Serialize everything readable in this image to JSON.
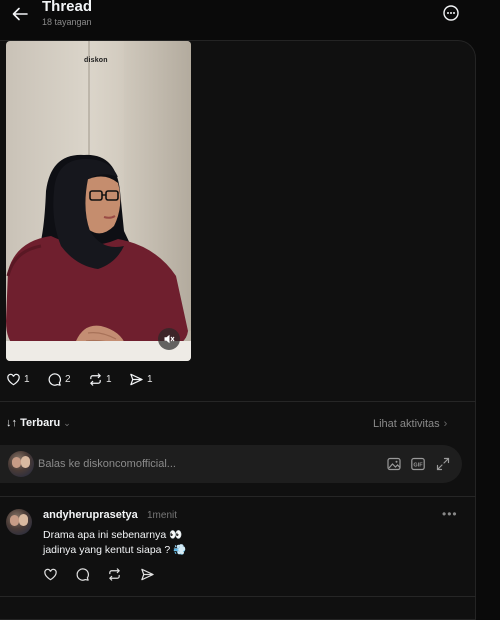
{
  "header": {
    "title": "Thread",
    "views": "18 tayangan"
  },
  "post": {
    "video_watermark": "diskon",
    "actions": {
      "likes": "1",
      "replies": "2",
      "reposts": "1",
      "shares": "1"
    }
  },
  "sort": {
    "label": "Terbaru",
    "activity_link": "Lihat aktivitas"
  },
  "reply_box": {
    "placeholder": "Balas ke diskoncomofficial..."
  },
  "comment": {
    "username": "andyheruprasetya",
    "time": "1menit",
    "line1": "Drama apa ini sebenarnya 👀",
    "line2": "jadinya yang kentut siapa ? 💨"
  },
  "icons": {
    "back": "arrow-left-icon",
    "more": "more-circle-icon",
    "mute": "speaker-muted-icon",
    "like": "heart-icon",
    "reply": "comment-bubble-icon",
    "repost": "repost-icon",
    "share": "send-icon",
    "image": "image-icon",
    "gif": "gif-icon",
    "expand": "expand-icon"
  },
  "colors": {
    "background": "#0a0a0a",
    "card": "#101010",
    "muted_text": "#8a8a8a",
    "reply_box": "#1e1e1e"
  }
}
